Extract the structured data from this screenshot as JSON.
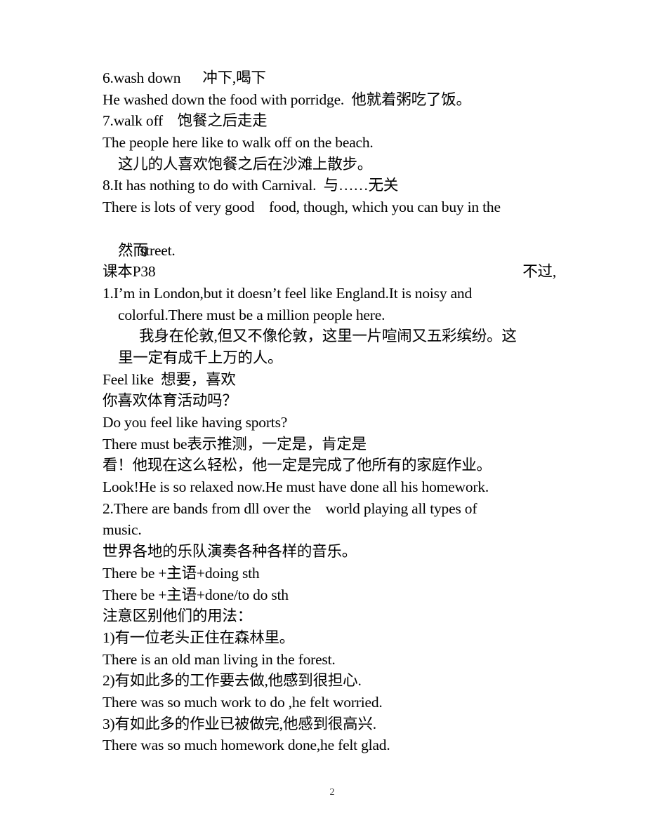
{
  "document": {
    "page_number": "2",
    "lines": [
      {
        "text": "6.wash down      冲下,喝下"
      },
      {
        "text": "He washed down the food with porridge.  他就着粥吃了饭。"
      },
      {
        "text": "7.walk off    饱餐之后走走"
      },
      {
        "text": "The people here like to walk off on the beach."
      },
      {
        "text": "这儿的人喜欢饱餐之后在沙滩上散步。"
      },
      {
        "text": "8.It has nothing to do with Carnival.  与……无关"
      },
      {
        "text": "There is lots of very good    food, though, which you can buy in the"
      },
      {
        "text": "street.",
        "right": "不过,"
      },
      {
        "text": "然而"
      },
      {
        "text": "课本P38"
      },
      {
        "text": "1.I’m in London,but it doesn’t feel like England.It is noisy and"
      },
      {
        "text": "colorful.There must be a million people here."
      },
      {
        "text": "我身在伦敦,但又不像伦敦，这里一片喧闹又五彩缤纷。这"
      },
      {
        "text": "里一定有成千上万的人。"
      },
      {
        "text": "Feel like  想要，喜欢"
      },
      {
        "text": "你喜欢体育活动吗？"
      },
      {
        "text": "Do you feel like having sports?"
      },
      {
        "text": "There must be表示推测，一定是，肯定是"
      },
      {
        "text": "看！他现在这么轻松，他一定是完成了他所有的家庭作业。"
      },
      {
        "text": "Look!He is so relaxed now.He must have done all his homework."
      },
      {
        "text": "2.There are bands from dll over the    world playing all types of"
      },
      {
        "text": "music."
      },
      {
        "text": "世界各地的乐队演奏各种各样的音乐。"
      },
      {
        "text": "There be +主语+doing sth"
      },
      {
        "text": "There be +主语+done/to do sth"
      },
      {
        "text": "注意区别他们的用法："
      },
      {
        "text": "1)有一位老头正住在森林里。"
      },
      {
        "text": "There is an old man living in the forest."
      },
      {
        "text": "2)有如此多的工作要去做,他感到很担心."
      },
      {
        "text": "There was so much work to do ,he felt worried."
      },
      {
        "text": "3)有如此多的作业已被做完,他感到很高兴."
      },
      {
        "text": "There was so much homework done,he felt glad."
      }
    ]
  }
}
